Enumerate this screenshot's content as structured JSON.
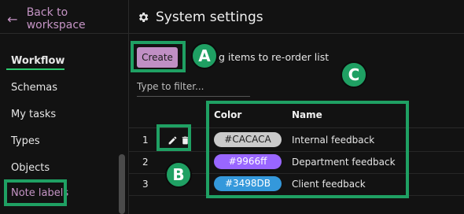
{
  "sidebar": {
    "back_label": "Back to workspace",
    "items": [
      {
        "label": "Workflow"
      },
      {
        "label": "Schemas"
      },
      {
        "label": "My tasks"
      },
      {
        "label": "Types"
      },
      {
        "label": "Objects"
      },
      {
        "label": "Note labels"
      }
    ]
  },
  "header": {
    "title": "System settings"
  },
  "toolbar": {
    "create_label": "Create",
    "hint": "g items to re-order list"
  },
  "filter": {
    "placeholder": "Type to filter..."
  },
  "table": {
    "columns": [
      "Color",
      "Name"
    ],
    "rows": [
      {
        "num": "1",
        "color_label": "#CACACA",
        "color": "#CACACA",
        "text_color": "#1a1a1a",
        "name": "Internal feedback"
      },
      {
        "num": "2",
        "color_label": "#9966ff",
        "color": "#9966ff",
        "text_color": "#ffffff",
        "name": "Department feedback"
      },
      {
        "num": "3",
        "color_label": "#3498DB",
        "color": "#3498DB",
        "text_color": "#ffffff",
        "name": "Client feedback"
      }
    ]
  },
  "annotations": {
    "a": "A",
    "b": "B",
    "c": "C",
    "highlight_color": "#1fa063"
  }
}
